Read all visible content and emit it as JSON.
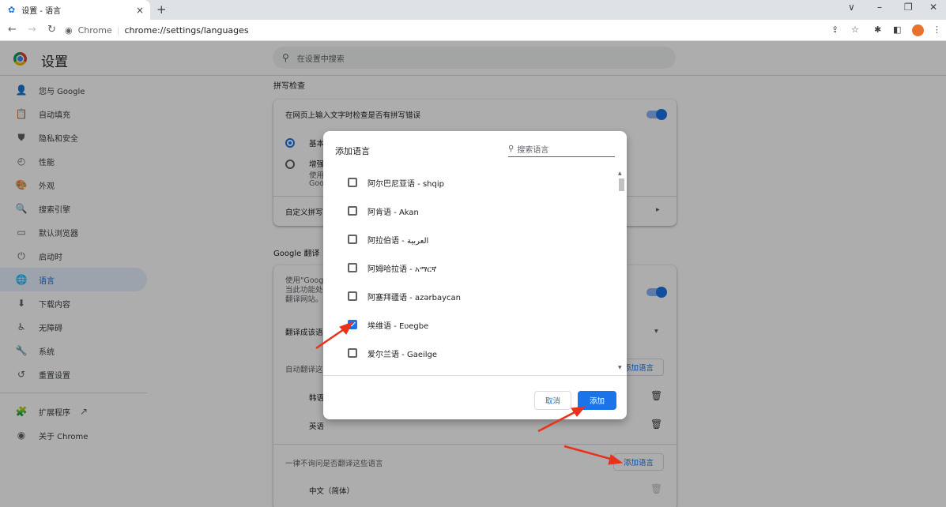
{
  "tab": {
    "title": "设置 - 语言",
    "close": "×",
    "newtab": "+"
  },
  "window_controls": {
    "dropdown": "∨",
    "minimize": "–",
    "restore": "❐",
    "close": "✕"
  },
  "omnibox": {
    "site": "Chrome",
    "separator": "|",
    "url": "chrome://settings/languages"
  },
  "settings": {
    "title": "设置",
    "search_placeholder": "在设置中搜索",
    "sidebar": [
      {
        "icon": "person-icon",
        "glyph": "👤",
        "label": "您与 Google"
      },
      {
        "icon": "clipboard-icon",
        "glyph": "📋",
        "label": "自动填充"
      },
      {
        "icon": "shield-icon",
        "glyph": "⛊",
        "label": "隐私和安全"
      },
      {
        "icon": "speed-icon",
        "glyph": "◴",
        "label": "性能"
      },
      {
        "icon": "palette-icon",
        "glyph": "🎨",
        "label": "外观"
      },
      {
        "icon": "search-icon",
        "glyph": "🔍",
        "label": "搜索引擎"
      },
      {
        "icon": "browser-icon",
        "glyph": "▭",
        "label": "默认浏览器"
      },
      {
        "icon": "power-icon",
        "glyph": "⏻",
        "label": "启动时"
      },
      {
        "icon": "globe-icon",
        "glyph": "🌐",
        "label": "语言",
        "active": true
      },
      {
        "icon": "download-icon",
        "glyph": "⬇",
        "label": "下载内容"
      },
      {
        "icon": "accessibility-icon",
        "glyph": "♿",
        "label": "无障碍"
      },
      {
        "icon": "wrench-icon",
        "glyph": "🔧",
        "label": "系统"
      },
      {
        "icon": "reset-icon",
        "glyph": "↺",
        "label": "重置设置"
      }
    ],
    "sidebar_extra": [
      {
        "icon": "puzzle-icon",
        "glyph": "🧩",
        "label": "扩展程序",
        "external": "↗"
      },
      {
        "icon": "chrome-icon",
        "glyph": "◉",
        "label": "关于 Chrome"
      }
    ],
    "spellcheck": {
      "section_title": "拼写检查",
      "row1": "在网页上输入文字时检查是否有拼写错误",
      "radio1_label": "基本",
      "radio2_label": "增强",
      "radio2_sub1": "使用",
      "radio2_sub2": "Goo",
      "custom_label": "自定义拼写"
    },
    "translate": {
      "section_title": "Google 翻译",
      "desc1": "使用\"Goog",
      "desc2": "当此功能处",
      "desc3": "翻译网站。",
      "translate_to": "翻译成该语",
      "auto_translate": "自动翻译这",
      "add_language_1": "添加语言",
      "lang_a": "韩语",
      "lang_b": "英语",
      "never_ask": "一律不询问是否翻译这些语言",
      "add_language_2": "添加语言",
      "lang_c": "中文（简体）"
    }
  },
  "dialog": {
    "title": "添加语言",
    "search_placeholder": "搜索语言",
    "languages": [
      {
        "label": "阿尔巴尼亚语 - shqip",
        "checked": false
      },
      {
        "label": "阿肯语 - Akan",
        "checked": false
      },
      {
        "label": "阿拉伯语 - العربية",
        "checked": false
      },
      {
        "label": "阿姆哈拉语 - አማርኛ",
        "checked": false
      },
      {
        "label": "阿塞拜疆语 - azərbaycan",
        "checked": false
      },
      {
        "label": "埃维语 - Eʋegbe",
        "checked": true
      },
      {
        "label": "爱尔兰语 - Gaeilge",
        "checked": false
      }
    ],
    "cancel": "取消",
    "add": "添加"
  }
}
